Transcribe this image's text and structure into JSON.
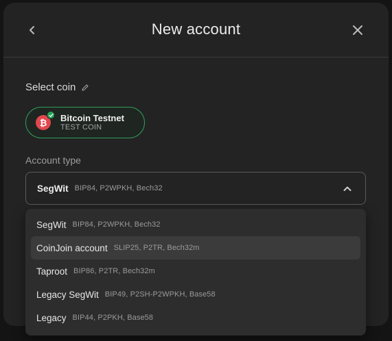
{
  "modal": {
    "title": "New account",
    "back_icon": "chevron-left-icon",
    "close_icon": "close-icon"
  },
  "coin_section": {
    "label": "Select coin",
    "edit_icon": "pencil-icon",
    "selected_coin": {
      "name": "Bitcoin Testnet",
      "subtitle": "TEST COIN",
      "logo_icon": "bitcoin-icon",
      "logo_color": "#e0484e",
      "check_icon": "check-icon",
      "check_color": "#27a55a"
    }
  },
  "account_type": {
    "label": "Account type",
    "selected": {
      "name": "SegWit",
      "desc": "BIP84, P2WPKH, Bech32"
    },
    "chevron_icon": "chevron-up-icon",
    "options": [
      {
        "name": "SegWit",
        "desc": "BIP84, P2WPKH, Bech32",
        "highlighted": false
      },
      {
        "name": "CoinJoin account",
        "desc": "SLIP25, P2TR, Bech32m",
        "highlighted": true
      },
      {
        "name": "Taproot",
        "desc": "BIP86, P2TR, Bech32m",
        "highlighted": false
      },
      {
        "name": "Legacy SegWit",
        "desc": "BIP49, P2SH-P2WPKH, Base58",
        "highlighted": false
      },
      {
        "name": "Legacy",
        "desc": "BIP44, P2PKH, Base58",
        "highlighted": false
      }
    ]
  },
  "colors": {
    "accent_green": "#2f9e58",
    "modal_bg": "#232324",
    "dropdown_bg": "#2d2d2e"
  }
}
